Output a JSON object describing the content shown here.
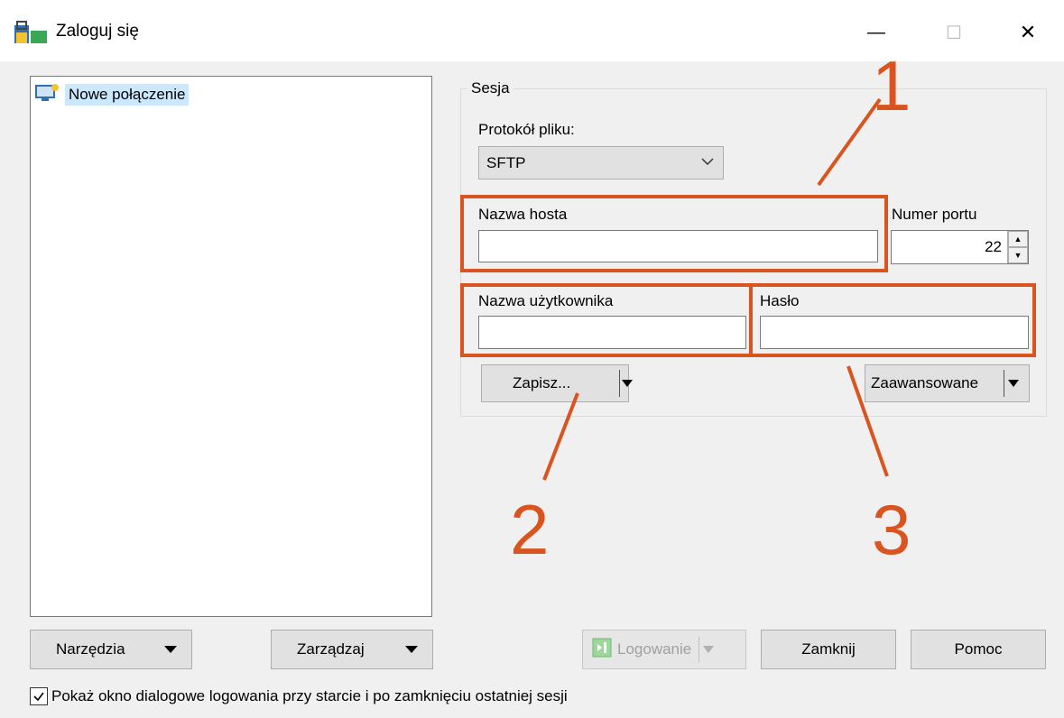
{
  "window": {
    "title": "Zaloguj się",
    "controls": {
      "minimize": "—",
      "maximize": "☐",
      "close": "✕"
    }
  },
  "sites": {
    "items": [
      {
        "label": "Nowe połączenie",
        "selected": true
      }
    ]
  },
  "session": {
    "group_label": "Sesja",
    "protocol_label": "Protokół pliku:",
    "protocol_value": "SFTP",
    "host_label": "Nazwa hosta",
    "host_value": "",
    "port_label": "Numer portu",
    "port_value": "22",
    "user_label": "Nazwa użytkownika",
    "user_value": "",
    "password_label": "Hasło",
    "password_value": "",
    "save_label": "Zapisz...",
    "advanced_label": "Zaawansowane"
  },
  "bottom": {
    "tools_label": "Narzędzia",
    "manage_label": "Zarządzaj",
    "login_label": "Logowanie",
    "close_label": "Zamknij",
    "help_label": "Pomoc",
    "checkbox_label": "Pokaż okno dialogowe logowania przy starcie i po zamknięciu ostatniej sesji",
    "checkbox_checked": true
  },
  "annotations": {
    "n1": "1",
    "n2": "2",
    "n3": "3"
  },
  "colors": {
    "annotation": "#d9541e",
    "selection": "#cce8ff"
  }
}
